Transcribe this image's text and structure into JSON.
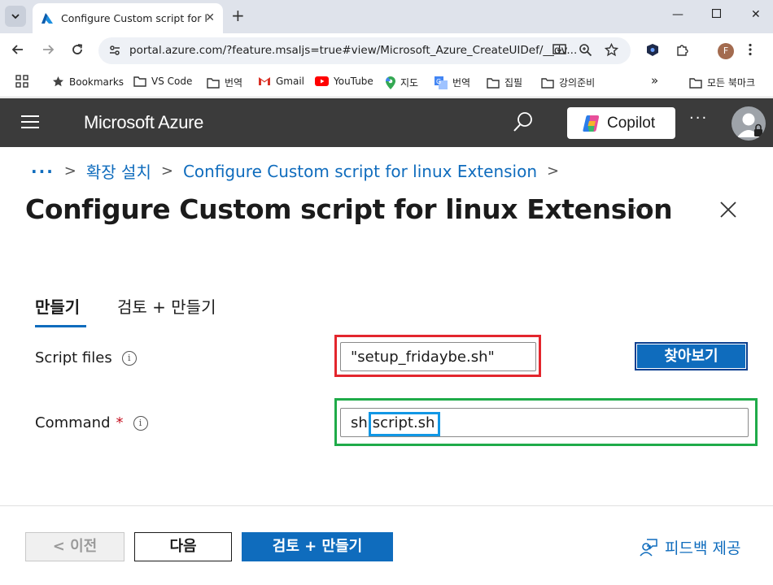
{
  "browser": {
    "tab_title": "Configure Custom script for lin",
    "url": "portal.azure.com/?feature.msaljs=true#view/Microsoft_Azure_CreateUIDef/__dv...",
    "profile_initial": "F",
    "bookmarks": [
      {
        "label": "Bookmarks",
        "icon": "star-icon"
      },
      {
        "label": "VS Code",
        "icon": "folder-icon"
      },
      {
        "label": "번역",
        "icon": "folder-icon"
      },
      {
        "label": "Gmail",
        "icon": "gmail-icon"
      },
      {
        "label": "YouTube",
        "icon": "youtube-icon"
      },
      {
        "label": "지도",
        "icon": "maps-icon"
      },
      {
        "label": "번역",
        "icon": "translate-icon"
      },
      {
        "label": "집필",
        "icon": "folder-icon"
      },
      {
        "label": "강의준비",
        "icon": "folder-icon"
      }
    ],
    "overflow": "»",
    "all_bookmarks": "모든 북마크"
  },
  "azure": {
    "brand": "Microsoft Azure",
    "copilot_label": "Copilot",
    "more": "···"
  },
  "breadcrumb": {
    "dots": "···",
    "items": [
      "확장 설치",
      "Configure Custom script for linux Extension"
    ]
  },
  "page": {
    "title": "Configure Custom script for linux Extension",
    "more": "···"
  },
  "tabs": [
    {
      "label": "만들기",
      "active": true
    },
    {
      "label": "검토 + 만들기",
      "active": false
    }
  ],
  "form": {
    "script_files_label": "Script files",
    "script_files_value": "\"setup_fridaybe.sh\"",
    "browse_label": "찾아보기",
    "command_label": "Command",
    "command_required": "*",
    "command_prefix": "sh",
    "command_highlight": "script.sh",
    "info_glyph": "i"
  },
  "footer": {
    "prev_label": "< 이전",
    "next_label": "다음",
    "review_label": "검토 + 만들기",
    "feedback_label": "피드백 제공"
  },
  "colors": {
    "azure_blue": "#0f6cbd",
    "header_bg": "#3b3b3b",
    "highlight_red": "#e3262d",
    "highlight_green": "#1fab49",
    "highlight_blue": "#1197e5",
    "required": "#c50f1f"
  }
}
